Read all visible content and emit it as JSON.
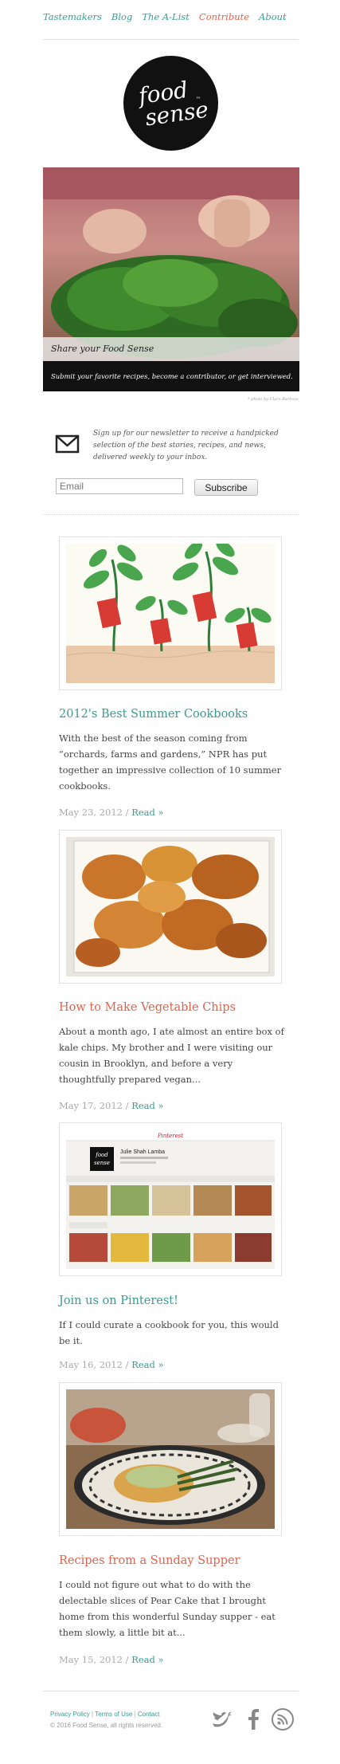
{
  "nav": {
    "items": [
      {
        "label": "Tastemakers",
        "active": false
      },
      {
        "label": "Blog",
        "active": false
      },
      {
        "label": "The A-List",
        "active": false
      },
      {
        "label": "Contribute",
        "active": true
      },
      {
        "label": "About",
        "active": false
      }
    ]
  },
  "logo": {
    "line1": "food",
    "line2": "sense",
    "tm": "™"
  },
  "hero": {
    "caption": "Share your Food Sense",
    "subtext": "Submit your favorite recipes, become a contributor, or get interviewed.",
    "credit": "* photo by Clare Barboza"
  },
  "newsletter": {
    "text": "Sign up for our newsletter to receive a handpicked selection of the best stories, recipes, and news, delivered weekly to your inbox.",
    "email_placeholder": "Email",
    "subscribe_label": "Subscribe"
  },
  "posts": [
    {
      "title": "2012's Best Summer Cookbooks",
      "excerpt": "With the best of the season coming from “orchards, farms and gardens,” NPR has put together an impressive collection of 10 summer cookbooks.",
      "date": "May 23, 2012 /",
      "read_more": "Read »",
      "image": "illustration of plants growing books"
    },
    {
      "title": "How to Make Vegetable Chips",
      "excerpt": "About a month ago, I ate almost an entire box of kale chips. My brother and I were visiting our cousin in Brooklyn, and before a very thoughtfully prepared vegan...",
      "date": "May 17, 2012 /",
      "read_more": "Read »",
      "image": "baked vegetable chips"
    },
    {
      "title": "Join us on Pinterest!",
      "excerpt": "If I could curate a cookbook for you, this would be it.",
      "date": "May 16, 2012 /",
      "read_more": "Read »",
      "image": "pinterest profile page screenshot",
      "pinterest": {
        "brand": "Pinterest",
        "profile_name": "Julie Shah Lamba",
        "logo_line1": "food",
        "logo_line2": "sense"
      }
    },
    {
      "title": "Recipes from a Sunday Supper",
      "excerpt": "I could not figure out what to do with the delectable slices of Pear Cake that I brought home from this wonderful Sunday supper - eat them slowly, a little bit at...",
      "date": "May 15, 2012 /",
      "read_more": "Read »",
      "image": "plate of food on patterned dish"
    }
  ],
  "footer": {
    "privacy": "Privacy Policy",
    "terms": "Terms of Use",
    "contact": "Contact",
    "sep": "|",
    "copyright": "© 2016 Food Sense, all rights reserved."
  },
  "social": [
    "twitter-icon",
    "facebook-icon",
    "rss-icon"
  ],
  "colors": {
    "teal": "#3c9a8e",
    "coral": "#e0634e",
    "black": "#111111"
  }
}
